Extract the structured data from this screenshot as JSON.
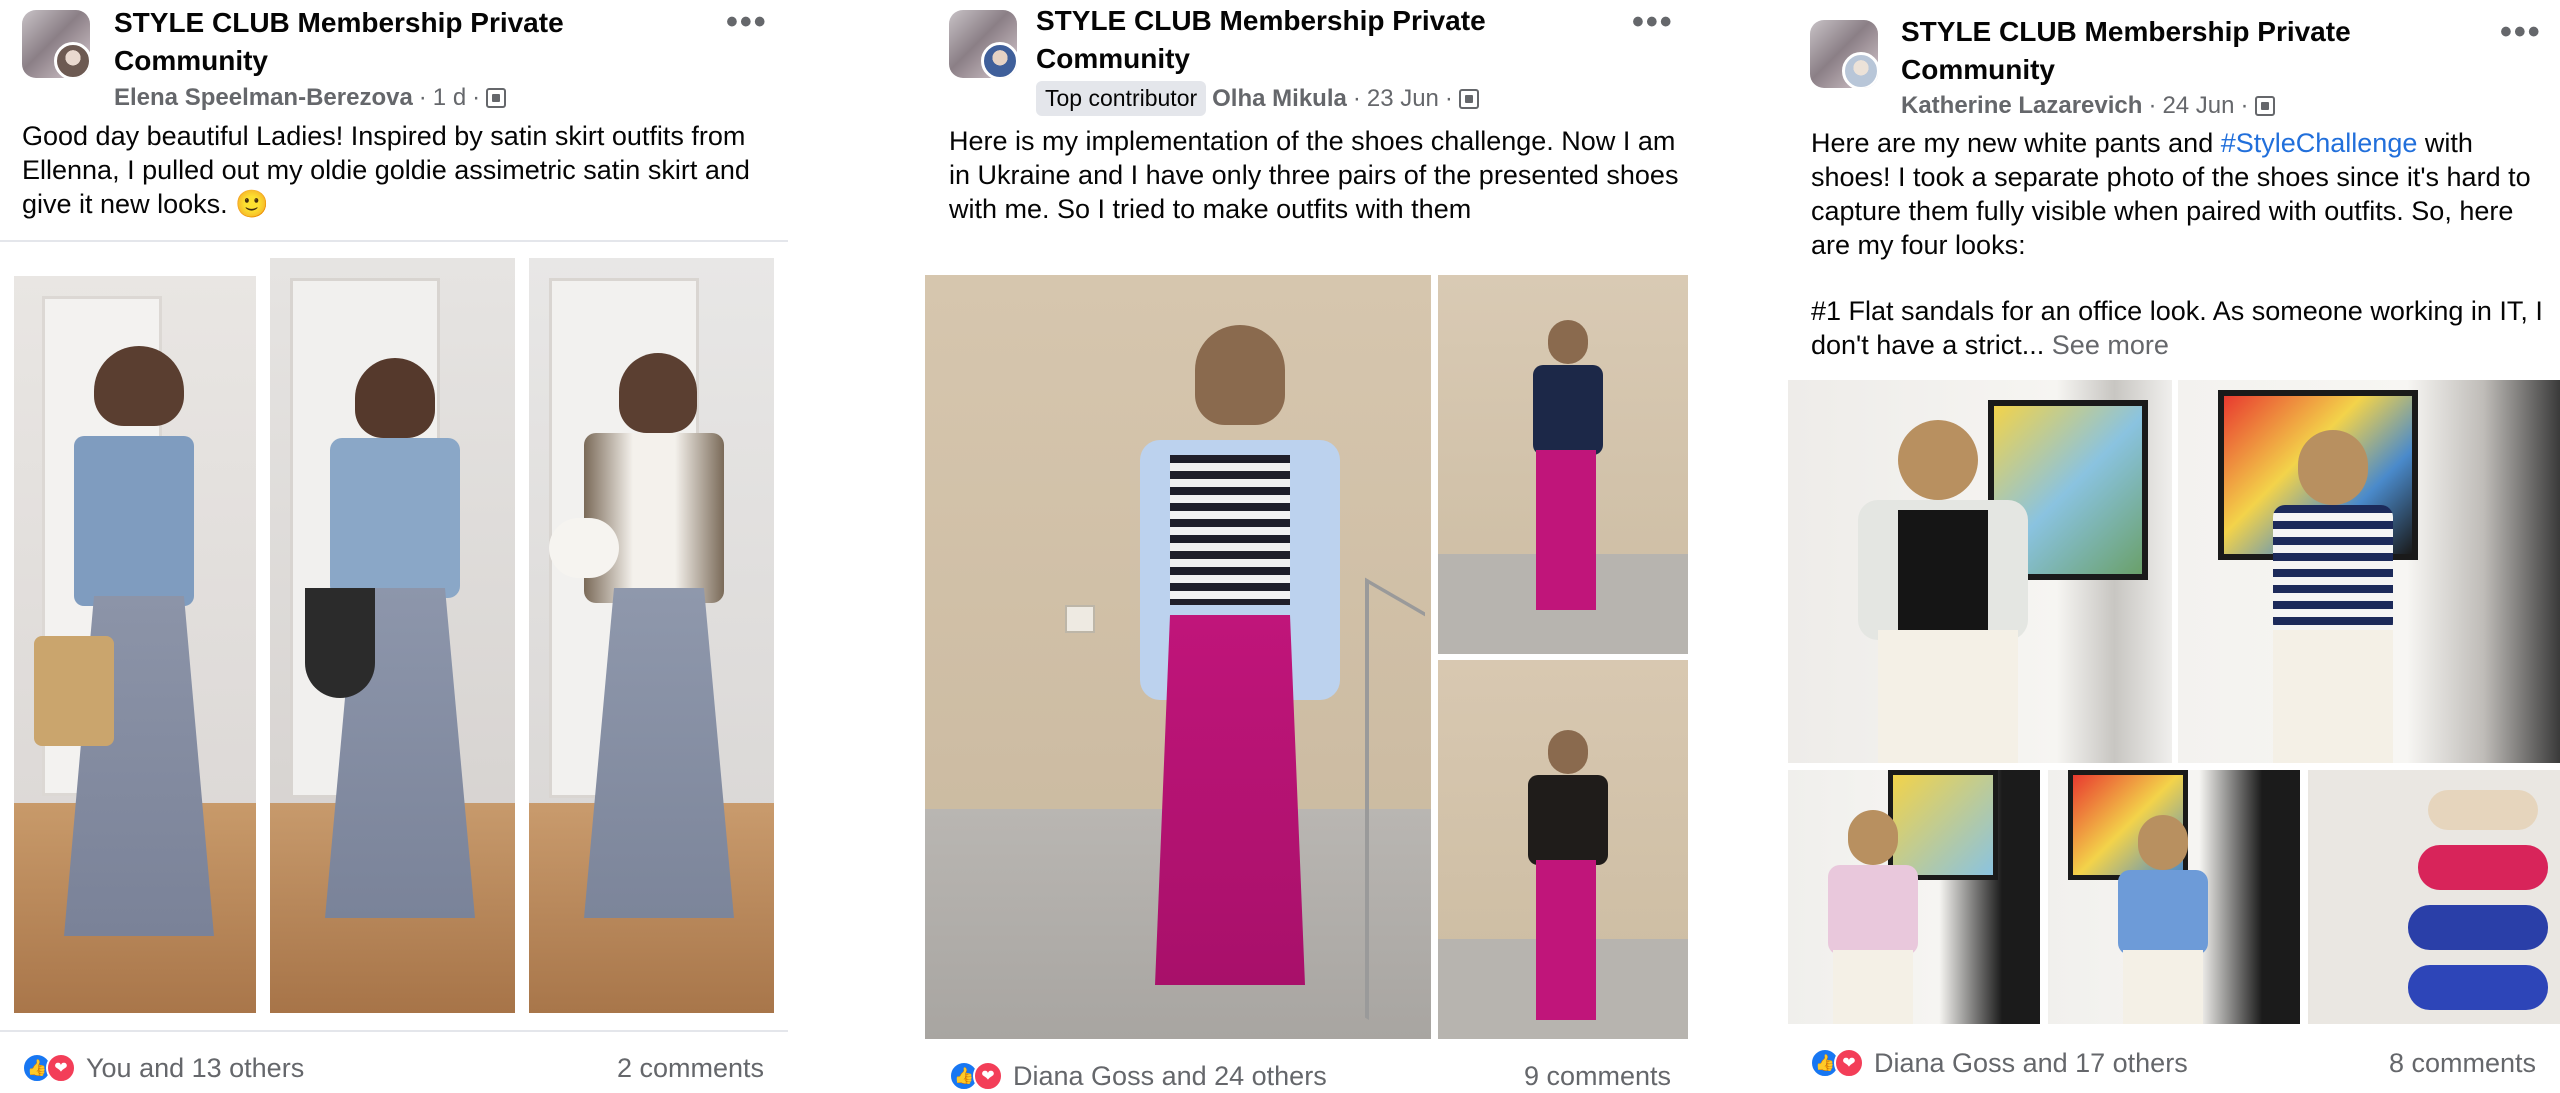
{
  "posts": [
    {
      "group": "STYLE CLUB Membership Private Community",
      "author": "Elena Speelman-Berezova",
      "badge": "",
      "time": "1 d",
      "text": "Good day beautiful Ladies! Inspired by satin skirt outfits from Ellenna, I pulled out my oldie goldie assimetric satin skirt and give it new looks. 🙂",
      "reactions": "You and 13 others",
      "comments": "2 comments"
    },
    {
      "group": "STYLE CLUB Membership Private Community",
      "author": "Olha Mikula",
      "badge": "Top contributor",
      "time": "23 Jun",
      "text": "Here is my implementation of the shoes challenge. Now I am in Ukraine and I have only three pairs of the presented shoes with me. So I tried to make outfits with them",
      "reactions": "Diana Goss and 24 others",
      "comments": "9 comments"
    },
    {
      "group": "STYLE CLUB Membership Private Community",
      "author": "Katherine Lazarevich",
      "badge": "",
      "time": "24 Jun",
      "text_before": "Here are my new white pants and ",
      "hashtag": "#StyleChallenge",
      "text_after": " with shoes! I took a separate photo of the shoes since it's hard to capture them fully visible when paired with outfits. So, here are my four looks:",
      "text_line2": "#1 Flat sandals for an office look. As someone working in IT, I don't have a strict...",
      "see_more": "See more",
      "reactions": "Diana Goss and 17 others",
      "comments": "8 comments"
    }
  ],
  "common": {
    "more_glyph": "•••",
    "dot": "·"
  },
  "icons": {
    "more": "more-options-icon",
    "audience": "group-members-icon",
    "like": "like-reaction-icon",
    "love": "love-reaction-icon"
  },
  "colors": {
    "text": "#050505",
    "secondary": "#65676b",
    "link": "#216fdb",
    "like": "#1877f2",
    "love": "#f33e58",
    "badge_bg": "#e4e6eb"
  }
}
